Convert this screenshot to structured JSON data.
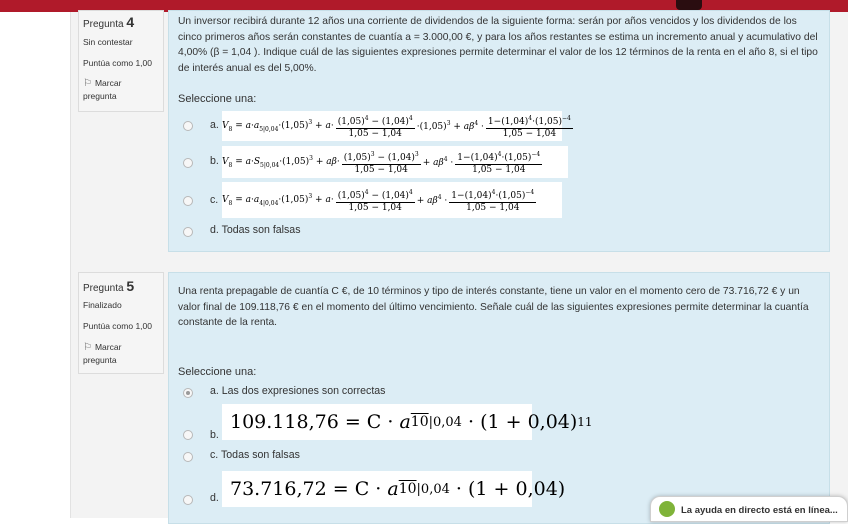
{
  "q4": {
    "label": "Pregunta",
    "number": "4",
    "state": "Sin contestar",
    "grade": "Puntúa como 1,00",
    "flag": "Marcar",
    "flag2": "pregunta",
    "text": "Un inversor recibirá durante 12 años una corriente de dividendos de la siguiente forma: serán por años vencidos y los dividendos de los cinco primeros años serán constantes de cuantía a = 3.000,00 €, y para los años restantes se estima un incremento anual y acumulativo del 4,00% (β = 1,04 ). Indique cuál de las siguientes expresiones permite determinar el valor de los 12 términos de la renta en el año 8, si el tipo de interés anual es del 5,00%.",
    "prompt": "Seleccione una:",
    "options": [
      "a.",
      "b.",
      "c.",
      "d. Todas son falsas"
    ]
  },
  "q5": {
    "label": "Pregunta",
    "number": "5",
    "state": "Finalizado",
    "grade": "Puntúa como 1,00",
    "flag": "Marcar",
    "flag2": "pregunta",
    "text": "Una renta prepagable de cuantía C €, de 10 términos y tipo de interés constante, tiene un valor en el momento cero de 73.716,72 € y un valor final de 109.118,76 € en el momento del último vencimiento. Señale cuál de las siguientes expresiones permite determinar la cuantía constante de la renta.",
    "prompt": "Seleccione una:",
    "options": [
      "a. Las dos expresiones son correctas",
      "b.",
      "c. Todas son falsas",
      "d."
    ],
    "formula_b": {
      "lhs": "109.118,76 = C ·",
      "a": "a",
      "ann": "10",
      "rate": "0,04",
      "tail": "· (1 + 0,04)",
      "exp": "11"
    },
    "formula_d": {
      "lhs": "73.716,72 = C ·",
      "a": "a",
      "ann": "10",
      "rate": "0,04",
      "tail": "· (1 + 0,04)"
    }
  },
  "chat": {
    "text": "La ayuda en directo está en línea..."
  },
  "colors": {
    "topbar": "#b01a2a",
    "panel": "#dcedf5",
    "chat_avatar": "#7fb339"
  }
}
